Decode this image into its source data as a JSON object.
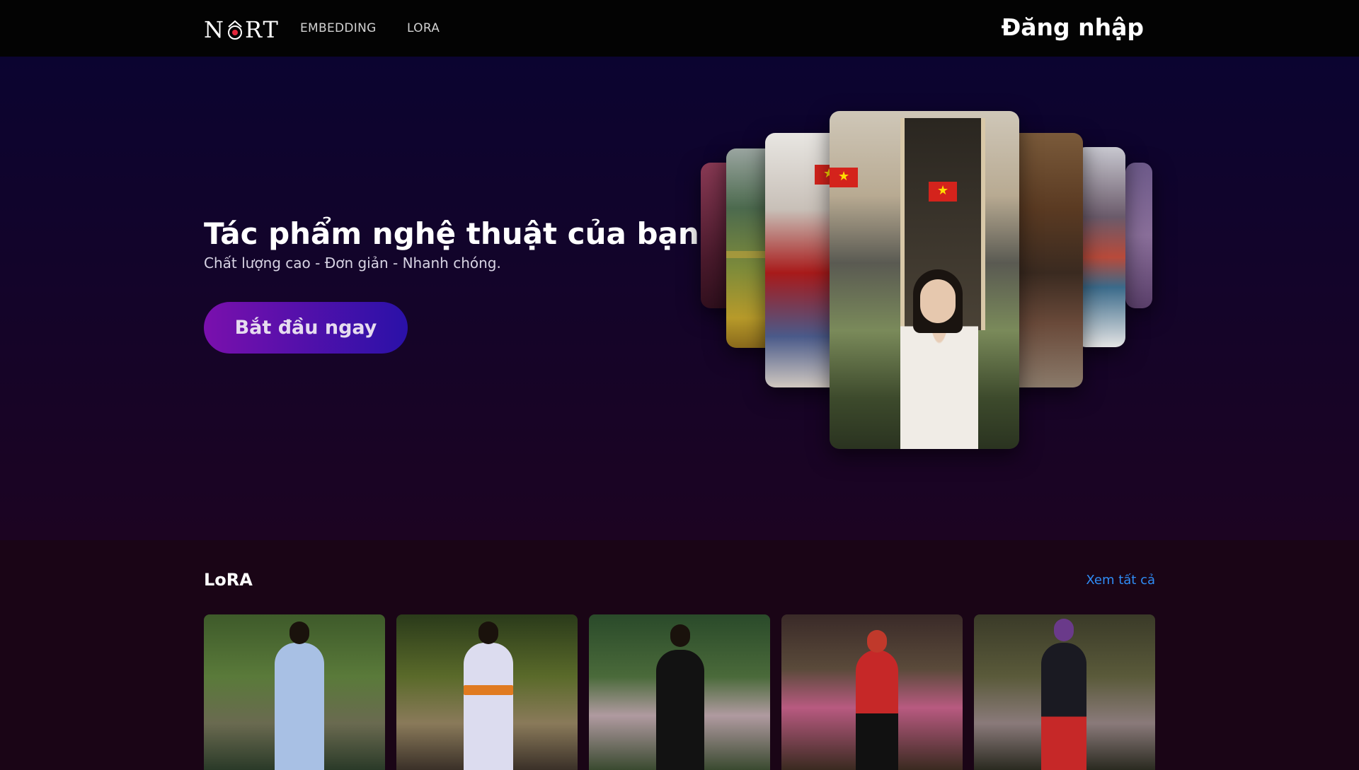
{
  "nav": {
    "logo": {
      "left": "N",
      "right": "RT"
    },
    "links": [
      "EMBEDDING",
      "LORA"
    ],
    "login_label": "Đăng nhập"
  },
  "hero": {
    "title": "Tác phẩm nghệ thuật của bạn",
    "subtitle": "Chất lượng cao - Đơn giản - Nhanh chóng.",
    "cta_label": "Bắt đầu ngay"
  },
  "lora": {
    "title": "LoRA",
    "see_all_label": "Xem tất cả"
  },
  "colors": {
    "nav_bg": "#030303",
    "cta_start": "#7a10ad",
    "cta_end": "#2a11a8",
    "link_blue": "#2f8cf5"
  }
}
